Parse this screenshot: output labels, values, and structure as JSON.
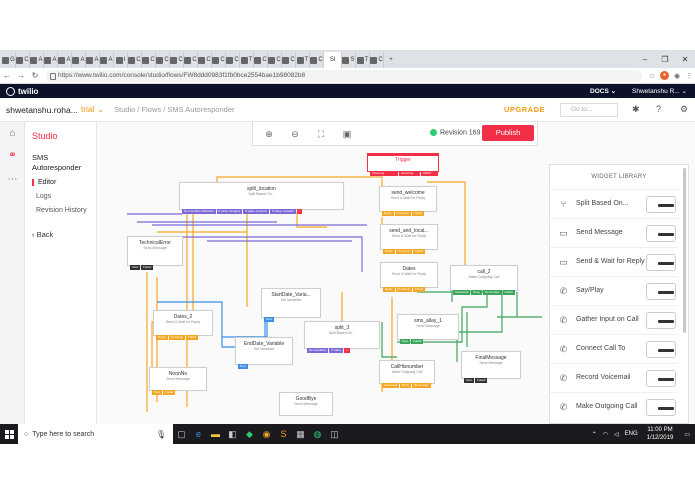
{
  "browser": {
    "tabs": [
      "G",
      "C",
      "A",
      "A",
      "A",
      "A",
      "A",
      "A",
      "I",
      "C",
      "C",
      "C",
      "C",
      "C",
      "C",
      "C",
      "C",
      "T",
      "C",
      "C",
      "C",
      "T",
      "C",
      "S",
      "T",
      "C"
    ],
    "active_tab": "Sl",
    "url": "https://www.twilio.com/console/studio/flows/FW8ddd0983f1fb0bce2554bae1b98082b8",
    "win_controls": [
      "–",
      "❐",
      "✕"
    ],
    "new_tab": "+"
  },
  "twilio": {
    "logo": "twilio",
    "docs": "DOCS ⌄",
    "user": "Shwetanshu R... ⌄"
  },
  "project": {
    "account": "shwetanshu.roha...",
    "trial": "trial ⌄",
    "breadcrumb": "Studio / Flows / SMS Autoresponder",
    "upgrade": "UPGRADE",
    "goto_placeholder": "Go to..."
  },
  "studio": {
    "title": "Studio",
    "service": "SMS Autoresponder",
    "nav": [
      "Editor",
      "Logs",
      "Revision History"
    ],
    "back": "‹ Back"
  },
  "canvas": {
    "revision": "Revision 169",
    "publish": "Publish",
    "trigger": "Trigger",
    "widgets": [
      {
        "title": "split_location",
        "sub": "Split Based On..."
      },
      {
        "title": "send_welcome",
        "sub": "Send & Wait for Reply"
      },
      {
        "title": "send_and_locat...",
        "sub": "Send & Wait for Reply"
      },
      {
        "title": "TechnicalError",
        "sub": "Send Message"
      },
      {
        "title": "Dates",
        "sub": "Send & Wait for Reply"
      },
      {
        "title": "call_2",
        "sub": "Make Outgoing Call"
      },
      {
        "title": "StartDate_Varia...",
        "sub": "Set Variables"
      },
      {
        "title": "Dates_2",
        "sub": "Send & Wait for Reply"
      },
      {
        "title": "split_3",
        "sub": "Split Based On..."
      },
      {
        "title": "sms_allay_1",
        "sub": "Send Message"
      },
      {
        "title": "EndDate_Variable",
        "sub": "Set Variables"
      },
      {
        "title": "NoonNo",
        "sub": "Send Message"
      },
      {
        "title": "CallHisnumber",
        "sub": "Make Outgoing Call"
      },
      {
        "title": "FinalMessage",
        "sub": "Send Message"
      },
      {
        "title": "GoodBye",
        "sub": "Send Message"
      }
    ]
  },
  "library": {
    "title": "WIDGET LIBRARY",
    "items": [
      {
        "label": "Split Based On...",
        "icon": "split-icon"
      },
      {
        "label": "Send Message",
        "icon": "message-icon"
      },
      {
        "label": "Send & Wait for Reply",
        "icon": "message-reply-icon"
      },
      {
        "label": "Say/Play",
        "icon": "phone-icon"
      },
      {
        "label": "Gather Input on Call",
        "icon": "phone-icon"
      },
      {
        "label": "Connect Call To",
        "icon": "phone-icon"
      },
      {
        "label": "Record Voicemail",
        "icon": "phone-icon"
      },
      {
        "label": "Make Outgoing Call",
        "icon": "phone-icon"
      }
    ]
  },
  "taskbar": {
    "search_placeholder": "Type here to search",
    "lang": "ENG",
    "time": "11:00 PM",
    "date": "1/12/2019"
  }
}
